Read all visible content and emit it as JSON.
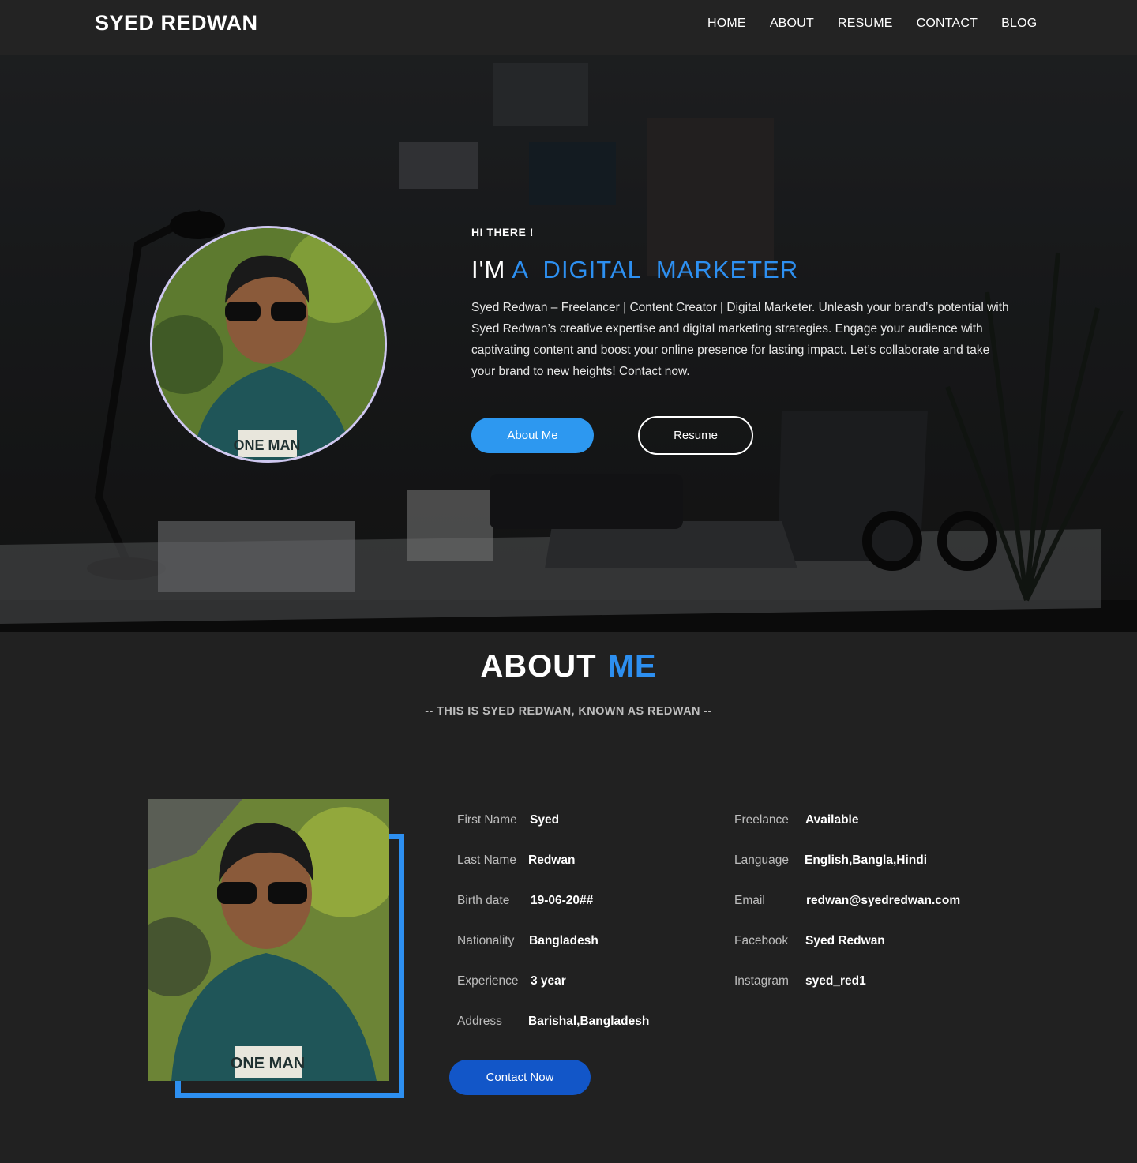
{
  "brand": "SYED REDWAN",
  "nav": [
    "HOME",
    "ABOUT",
    "RESUME",
    "CONTACT",
    "BLOG"
  ],
  "hero": {
    "greeting": "HI THERE !",
    "headline_prefix": "I'M",
    "headline_accent": "A  DIGITAL  MARKETER",
    "intro": "Syed Redwan – Freelancer | Content Creator | Digital Marketer. Unleash your brand’s potential with Syed Redwan’s creative expertise and digital marketing strategies. Engage your audience with captivating content and boost your online presence for lasting impact. Let’s collaborate and take your brand to new heights! Contact now.",
    "about_button": "About Me",
    "resume_button": "Resume",
    "avatar_shirt_text": "ONE MAN"
  },
  "about": {
    "title_main": "ABOUT",
    "title_accent": "ME",
    "subtitle": "-- THIS IS SYED REDWAN, KNOWN AS REDWAN --",
    "photo_shirt_text": "ONE MAN",
    "left": [
      {
        "label": "First Name",
        "value": "Syed"
      },
      {
        "label": "Last Name",
        "value": "Redwan"
      },
      {
        "label": "Birth date",
        "value": "19-06-20##"
      },
      {
        "label": "Nationality",
        "value": "Bangladesh"
      },
      {
        "label": "Experience",
        "value": "3 year"
      },
      {
        "label": "Address",
        "value": "Barishal,Bangladesh"
      }
    ],
    "right": [
      {
        "label": "Freelance",
        "value": "Available"
      },
      {
        "label": "Language",
        "value": "English,Bangla,Hindi"
      },
      {
        "label": "Email",
        "value": "redwan@syedredwan.com"
      },
      {
        "label": "Facebook",
        "value": "Syed Redwan"
      },
      {
        "label": "Instagram",
        "value": "syed_red1"
      }
    ],
    "contact_button": "Contact Now"
  },
  "colors": {
    "accent": "#2d8ff0",
    "button_blue": "#2d98f0",
    "contact_blue": "#1256c8",
    "background": "#212121"
  }
}
